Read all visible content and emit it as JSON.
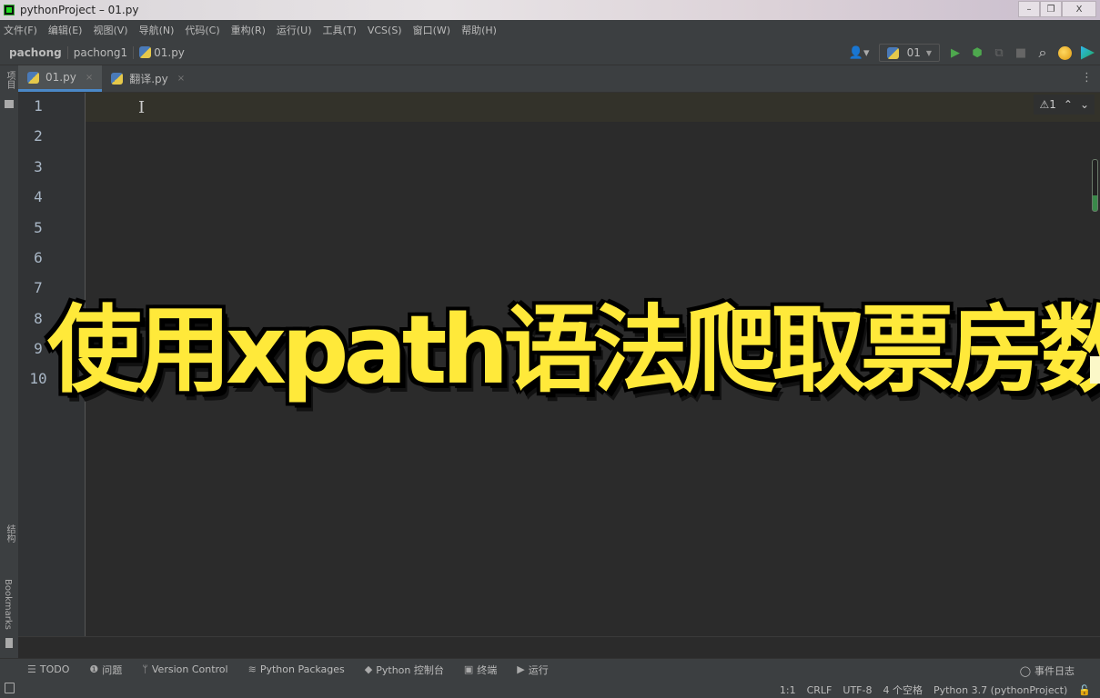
{
  "window": {
    "title": "pythonProject – 01.py",
    "controls": {
      "minimize": "–",
      "restore": "❐",
      "close": "X"
    }
  },
  "menu": [
    "文件(F)",
    "编辑(E)",
    "视图(V)",
    "导航(N)",
    "代码(C)",
    "重构(R)",
    "运行(U)",
    "工具(T)",
    "VCS(S)",
    "窗口(W)",
    "帮助(H)"
  ],
  "breadcrumb": {
    "project": "pachong",
    "folder": "pachong1",
    "file": "01.py"
  },
  "nav_toolbar": {
    "user_icon": "👤▾",
    "run_config": "01",
    "run_config_arrow": "▼",
    "run_icon": "▶",
    "debug_icon": "⬢",
    "coverage_icon": "⧉",
    "stop_icon": "■",
    "search_icon": "⌕"
  },
  "left_strip": {
    "project_label": "项目",
    "structure_label": "结构",
    "bookmarks_label": "Bookmarks"
  },
  "tabs": [
    {
      "label": "01.py",
      "active": true
    },
    {
      "label": "翻译.py",
      "active": false
    }
  ],
  "tabs_more": "⋮",
  "tab_close": "×",
  "editor": {
    "line_numbers": [
      "1",
      "2",
      "3",
      "4",
      "5",
      "6",
      "7",
      "8",
      "9",
      "10"
    ],
    "caret": "I",
    "inspection": {
      "warning_icon": "⚠",
      "count": "1",
      "up": "⌃",
      "down": "⌄"
    }
  },
  "overlay": {
    "title": "使用xpath语法爬取票房数据",
    "color": "#ffe93a"
  },
  "tool_windows": [
    {
      "icon": "☰",
      "label": "TODO"
    },
    {
      "icon": "❶",
      "label": "问题"
    },
    {
      "icon": "ᛘ",
      "label": "Version Control"
    },
    {
      "icon": "≋",
      "label": "Python Packages"
    },
    {
      "icon": "◆",
      "label": "Python 控制台"
    },
    {
      "icon": "▣",
      "label": "终端"
    },
    {
      "icon": "▶",
      "label": "运行"
    }
  ],
  "event_log": {
    "icon": "◯",
    "label": "事件日志"
  },
  "status": {
    "position": "1:1",
    "line_sep": "CRLF",
    "encoding": "UTF-8",
    "indent": "4 个空格",
    "interpreter": "Python 3.7 (pythonProject)",
    "lock_icon": "🔓"
  }
}
